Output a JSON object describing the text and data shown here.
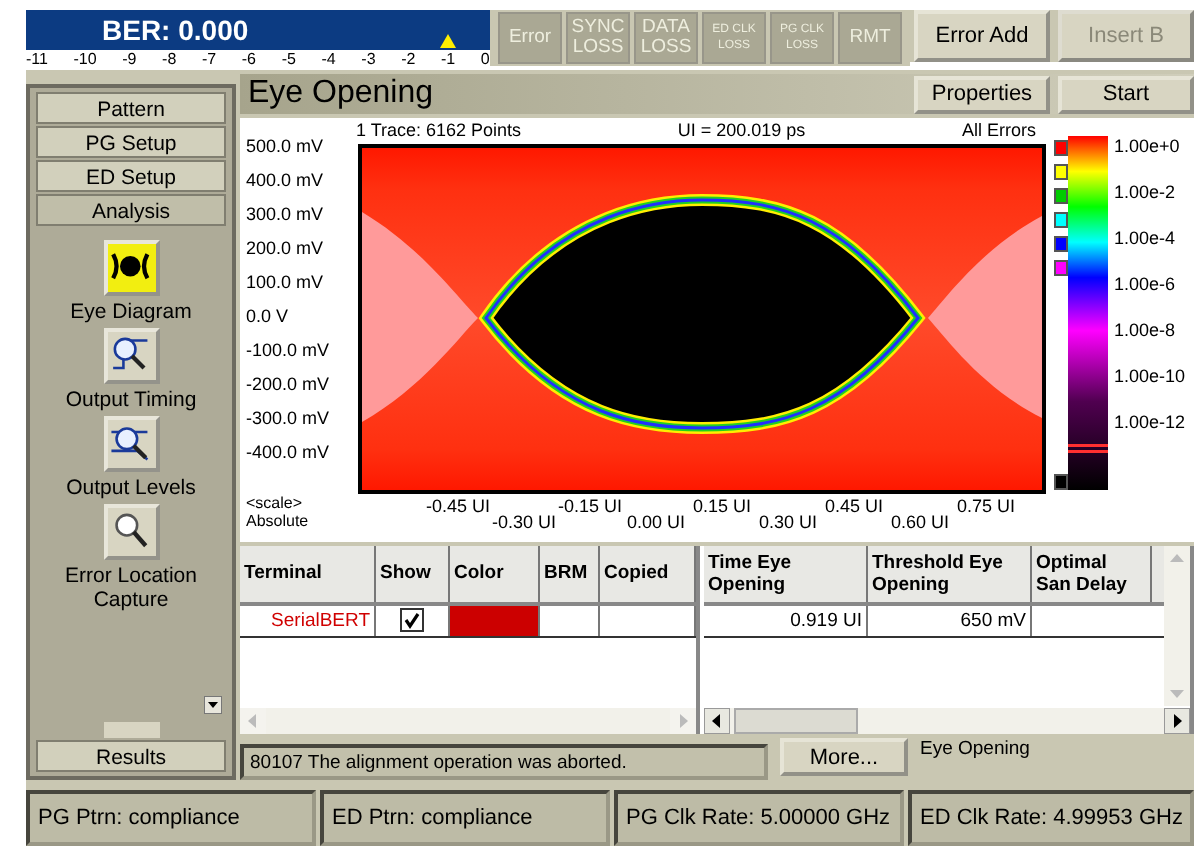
{
  "ber": {
    "label": "BER: 0.000",
    "level": 0.91,
    "scale": [
      "-11",
      "-10",
      "-9",
      "-8",
      "-7",
      "-6",
      "-5",
      "-4",
      "-3",
      "-2",
      "-1",
      "0"
    ]
  },
  "indicators": [
    {
      "label": "Error",
      "kind": "large"
    },
    {
      "label": "SYNC LOSS",
      "kind": "large"
    },
    {
      "label": "DATA LOSS",
      "kind": "large"
    },
    {
      "label": "ED CLK LOSS",
      "kind": "small"
    },
    {
      "label": "PG CLK LOSS",
      "kind": "small"
    },
    {
      "label": "RMT",
      "kind": "large"
    }
  ],
  "top_buttons": [
    {
      "label": "Error Add",
      "disabled": false
    },
    {
      "label": "Insert B",
      "disabled": true
    }
  ],
  "nav": {
    "tabs": [
      {
        "label": "Pattern",
        "selected": false
      },
      {
        "label": "PG Setup",
        "selected": false
      },
      {
        "label": "ED Setup",
        "selected": false
      },
      {
        "label": "Analysis",
        "selected": true
      }
    ],
    "tools": [
      {
        "label": "Eye Diagram",
        "kind": "eye",
        "selected": true
      },
      {
        "label": "Output Timing",
        "kind": "timing",
        "selected": false
      },
      {
        "label": "Output Levels",
        "kind": "levels",
        "selected": false
      },
      {
        "label": "Error Location Capture",
        "kind": "capture",
        "selected": false
      }
    ],
    "bottom_tabs": [
      {
        "label": "Results",
        "selected": false
      }
    ]
  },
  "page": {
    "title": "Eye Opening",
    "buttons": [
      {
        "label": "Properties",
        "disabled": false
      },
      {
        "label": "Start",
        "disabled": false
      }
    ]
  },
  "eye_plot": {
    "trace_info": "1 Trace: 6162 Points",
    "ui": "UI = 200.019 ps",
    "filter": "All Errors",
    "y_labels": [
      "500.0 mV",
      "400.0 mV",
      "300.0 mV",
      "200.0 mV",
      "100.0 mV",
      "0.0 V",
      "-100.0 mV",
      "-200.0 mV",
      "-300.0 mV",
      "-400.0 mV"
    ],
    "x_labels": [
      "-0.45 UI",
      "-0.30 UI",
      "-0.15 UI",
      "0.00 UI",
      "0.15 UI",
      "0.30 UI",
      "0.45 UI",
      "0.60 UI",
      "0.75 UI"
    ],
    "scale_label": "<scale>",
    "scale_mode": "Absolute",
    "colorbar": {
      "labels": [
        "1.00e+0",
        "1.00e-2",
        "1.00e-4",
        "1.00e-6",
        "1.00e-8",
        "1.00e-10",
        "1.00e-12"
      ],
      "markers": [
        {
          "color": "#ff0000"
        },
        {
          "color": "#ffff00"
        },
        {
          "color": "#00cc00"
        },
        {
          "color": "#00ffff"
        },
        {
          "color": "#0000ff"
        },
        {
          "color": "#ff00ff"
        },
        {
          "color": "#000000"
        }
      ]
    }
  },
  "left_table": {
    "columns": [
      "Terminal",
      "Show",
      "Color",
      "BRM",
      "Copied"
    ],
    "rows": [
      {
        "terminal": "SerialBERT",
        "show": true,
        "color": "#cc0000",
        "brm": "",
        "copied": ""
      }
    ]
  },
  "right_table": {
    "columns": [
      "Time Eye Opening",
      "Threshold Eye Opening",
      "Optimal San Delay"
    ],
    "rows": [
      [
        "0.919 UI",
        "650 mV"
      ]
    ]
  },
  "message": {
    "text": "80107 The alignment operation was aborted.",
    "button": "More...",
    "context": "Eye Opening"
  },
  "status_bar": [
    "PG Ptrn: compliance",
    "ED Ptrn: compliance",
    "PG Clk Rate: 5.00000 GHz",
    "ED Clk Rate: 4.99953 GHz"
  ]
}
